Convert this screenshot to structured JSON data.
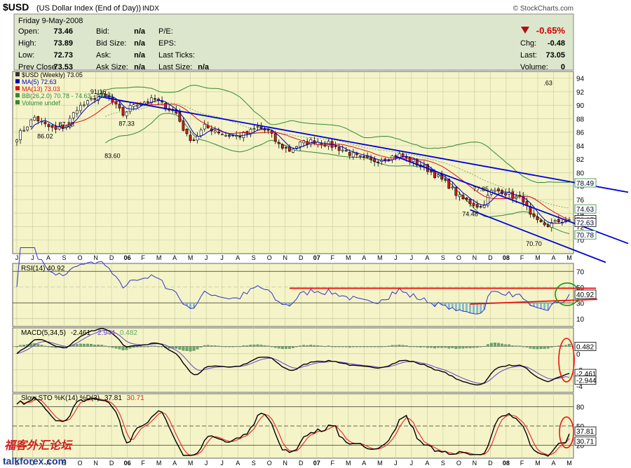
{
  "header": {
    "symbol": "$USD",
    "name": "(US Dollar Index (End of Day))",
    "exchange": "INDX",
    "copyright": "© StockCharts.com",
    "date": "Friday  9-May-2008",
    "change_pct": "-0.65%",
    "fields": [
      {
        "label": "Open:",
        "value": "73.46"
      },
      {
        "label": "High:",
        "value": "73.89"
      },
      {
        "label": "Low:",
        "value": "72.73"
      },
      {
        "label": "Prev Close:",
        "value": "73.53"
      }
    ],
    "fields2": [
      {
        "label": "Bid:",
        "value": "n/a"
      },
      {
        "label": "Bid Size:",
        "value": "n/a"
      },
      {
        "label": "Ask:",
        "value": "n/a"
      },
      {
        "label": "Ask Size:",
        "value": "n/a"
      }
    ],
    "fields3": [
      {
        "label": "P/E:",
        "value": ""
      },
      {
        "label": "EPS:",
        "value": ""
      },
      {
        "label": "Last Ticks:",
        "value": ""
      },
      {
        "label": "Last Size:",
        "value": "n/a"
      }
    ],
    "fields4": [
      {
        "label": "Chg:",
        "value": "-0.48"
      },
      {
        "label": "Last:",
        "value": "73.05"
      },
      {
        "label": "Volume:",
        "value": "0"
      }
    ]
  },
  "colors": {
    "panel_bg": "#f4f4c8",
    "header_bg": "#dce6cc",
    "up_candle": "#ffffff",
    "down_candle": "#d81818",
    "ma5": "#0000cc",
    "ma13": "#dd1111",
    "bb": "#338833",
    "trendline": "#0000dd",
    "annotation": "#ee1111",
    "circle_green": "#119911",
    "rsi": "#3333cc",
    "macd": "#000000",
    "signal": "#6644cc",
    "hist": "#66aa66",
    "stok": "#000000",
    "stod": "#ee2222"
  },
  "chart_data": [
    {
      "type": "candlestick",
      "title": "$USD (Weekly) 73.05",
      "legend": [
        "$USD (Weekly) 73.05",
        "MA(5) 72.63",
        "MA(13) 73.03",
        "BB(26,2.0) 70.78 - 74.63 - 78.49",
        "Volume undef"
      ],
      "ylim": [
        68,
        95
      ],
      "y_ticks": [
        70,
        72,
        74,
        76,
        78,
        80,
        82,
        84,
        86,
        88,
        90,
        92,
        94
      ],
      "x_tick_labels": [
        "J",
        "J",
        "A",
        "S",
        "O",
        "N",
        "D",
        "06",
        "F",
        "M",
        "A",
        "M",
        "J",
        "J",
        "A",
        "S",
        "O",
        "N",
        "D",
        "07",
        "F",
        "M",
        "A",
        "M",
        "J",
        "J",
        "A",
        "S",
        "O",
        "N",
        "D",
        "08",
        "F",
        "M",
        "A",
        "M"
      ],
      "close_anchors": [
        [
          0,
          85.3
        ],
        [
          5,
          88.2
        ],
        [
          8,
          87.0
        ],
        [
          11,
          86.3
        ],
        [
          14,
          87.0
        ],
        [
          17,
          89.6
        ],
        [
          20,
          90.3
        ],
        [
          23,
          91.6
        ],
        [
          26,
          91.0
        ],
        [
          30,
          88.6
        ],
        [
          33,
          90.2
        ],
        [
          36,
          90.5
        ],
        [
          39,
          90.8
        ],
        [
          42,
          89.8
        ],
        [
          45,
          88.8
        ],
        [
          48,
          85.4
        ],
        [
          50,
          84.9
        ],
        [
          53,
          86.8
        ],
        [
          56,
          86.3
        ],
        [
          59,
          85.6
        ],
        [
          62,
          85.4
        ],
        [
          65,
          85.8
        ],
        [
          68,
          86.7
        ],
        [
          71,
          86.1
        ],
        [
          74,
          84.1
        ],
        [
          77,
          83.3
        ],
        [
          80,
          84.3
        ],
        [
          84,
          84.7
        ],
        [
          88,
          84.2
        ],
        [
          92,
          83.4
        ],
        [
          96,
          82.3
        ],
        [
          100,
          81.7
        ],
        [
          104,
          82.2
        ],
        [
          108,
          82.6
        ],
        [
          112,
          81.6
        ],
        [
          116,
          80.5
        ],
        [
          119,
          79.3
        ],
        [
          122,
          78.1
        ],
        [
          125,
          76.3
        ],
        [
          128,
          75.6
        ],
        [
          131,
          74.9
        ],
        [
          134,
          77.2
        ],
        [
          137,
          77.3
        ],
        [
          140,
          76.5
        ],
        [
          143,
          76.0
        ],
        [
          145,
          73.5
        ],
        [
          147,
          72.6
        ],
        [
          150,
          72.2
        ],
        [
          153,
          72.8
        ],
        [
          156,
          73.05
        ]
      ],
      "price_labels": [
        {
          "x": 8,
          "text": "86.02"
        },
        {
          "x": 23,
          "text": "91.16"
        },
        {
          "x": 14,
          "text": "87.83"
        },
        {
          "x": 31,
          "text": "87.33"
        },
        {
          "x": 27,
          "text": "83.60"
        },
        {
          "x": 150,
          "text": ".63"
        },
        {
          "x": 131,
          "text": "77.85"
        },
        {
          "x": 128,
          "text": "74.48"
        },
        {
          "x": 146,
          "text": "70.70"
        }
      ],
      "right_labels": [
        "78.49",
        "74.63",
        "73.05",
        "72.63",
        "70.78"
      ],
      "annotations": "three blue resistance trendlines"
    },
    {
      "type": "line",
      "title": "RSI(14) 40.92",
      "ylim": [
        0,
        80
      ],
      "y_ticks": [
        10,
        30,
        50,
        70
      ],
      "last_value": "40.92",
      "annotations": "red horizontal line near 50 and red rising line near 30; green circle at latest value"
    },
    {
      "type": "line",
      "title": "MACD(5,34,5)",
      "values": {
        "macd": "-2.461",
        "signal": "-2.944",
        "hist": "0.482"
      },
      "y_ticks": [
        -4,
        -2,
        0
      ],
      "right_labels": [
        "0.482",
        "-2.461",
        "-2.944"
      ],
      "annotations": "red ellipse at latest value"
    },
    {
      "type": "line",
      "title": "Slow STO %K(14) %D(3)",
      "values": {
        "k": "37.81",
        "d": "30.71"
      },
      "ylim": [
        0,
        100
      ],
      "y_ticks": [
        20,
        50,
        80
      ],
      "right_labels": [
        "37.81",
        "30.71"
      ],
      "annotations": "red ellipse at latest value"
    }
  ],
  "watermark": {
    "cn": "福客外汇论坛",
    "en": "talkforex.com"
  }
}
